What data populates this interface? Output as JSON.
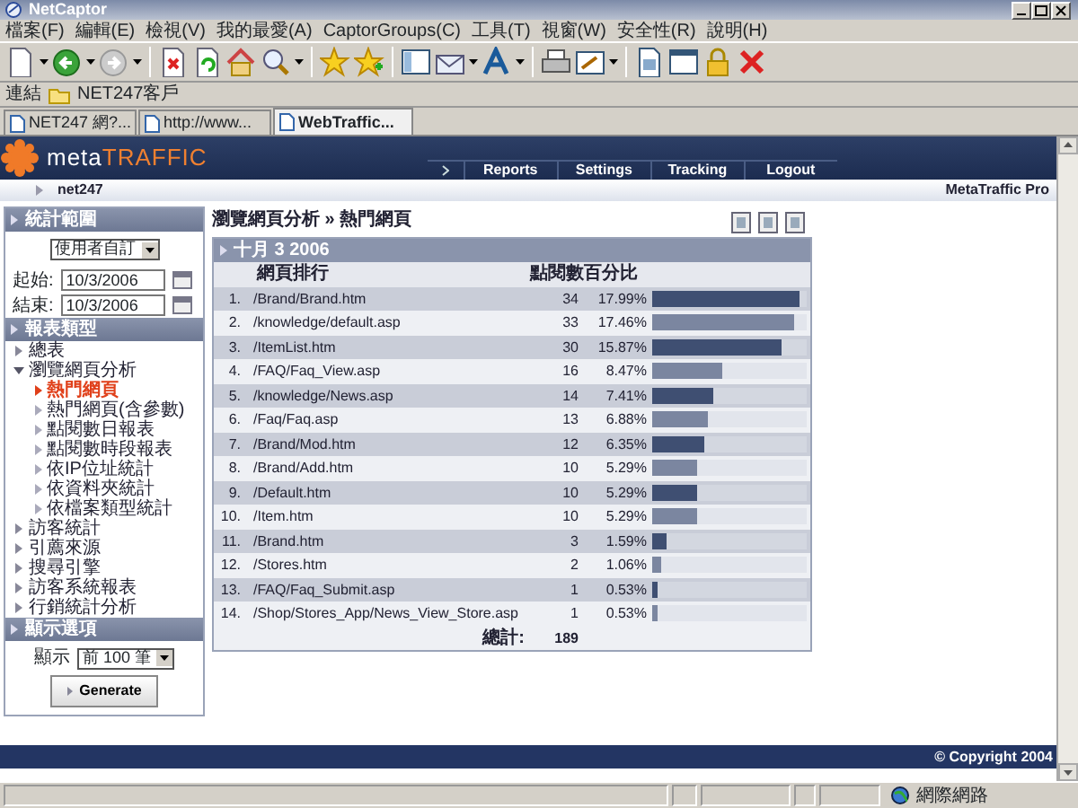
{
  "window": {
    "title": "NetCaptor"
  },
  "menu": [
    "檔案(F)",
    "編輯(E)",
    "檢視(V)",
    "我的最愛(A)",
    "CaptorGroups(C)",
    "工具(T)",
    "視窗(W)",
    "安全性(R)",
    "說明(H)"
  ],
  "links_bar": {
    "label": "連結",
    "items": [
      "NET247客戶"
    ]
  },
  "tabs": [
    {
      "label": "NET247 網?...",
      "selected": false
    },
    {
      "label": "http://www...",
      "selected": false
    },
    {
      "label": "WebTraffic...",
      "selected": true
    }
  ],
  "site": {
    "logo": {
      "prefix": "meta",
      "suffix": "TRAFFIC"
    },
    "nav": [
      "Reports",
      "Settings",
      "Tracking",
      "Logout"
    ],
    "account": "net247",
    "product": "MetaTraffic Pro",
    "footer": "© Copyright 2004"
  },
  "sidebar": {
    "range": {
      "title": "統計範圍",
      "preset": "使用者自訂",
      "start_label": "起始:",
      "start": "10/3/2006",
      "end_label": "結束:",
      "end": "10/3/2006"
    },
    "report_types": {
      "title": "報表類型",
      "items": [
        {
          "label": "總表",
          "expanded": false,
          "selected": false
        },
        {
          "label": "瀏覽網頁分析",
          "expanded": true,
          "selected": false,
          "children": [
            {
              "label": "熱門網頁",
              "selected": true
            },
            {
              "label": "熱門網頁(含參數)",
              "selected": false
            },
            {
              "label": "點閱數日報表",
              "selected": false
            },
            {
              "label": "點閱數時段報表",
              "selected": false
            },
            {
              "label": "依IP位址統計",
              "selected": false
            },
            {
              "label": "依資料夾統計",
              "selected": false
            },
            {
              "label": "依檔案類型統計",
              "selected": false
            }
          ]
        },
        {
          "label": "訪客統計",
          "expanded": false,
          "selected": false
        },
        {
          "label": "引薦來源",
          "expanded": false,
          "selected": false
        },
        {
          "label": "搜尋引擎",
          "expanded": false,
          "selected": false
        },
        {
          "label": "訪客系統報表",
          "expanded": false,
          "selected": false
        },
        {
          "label": "行銷統計分析",
          "expanded": false,
          "selected": false
        }
      ]
    },
    "display": {
      "title": "顯示選項",
      "label": "顯示",
      "value": "前 100 筆",
      "button": "Generate"
    }
  },
  "report": {
    "breadcrumb": "瀏覽網頁分析 » 熱門網頁",
    "date": "十月 3 2006",
    "columns": [
      "網頁排行",
      "點閱數",
      "百分比"
    ],
    "rows": [
      {
        "rank": "1.",
        "page": "/Brand/Brand.htm",
        "hits": "34",
        "percent": "17.99%",
        "level": 0.95
      },
      {
        "rank": "2.",
        "page": "/knowledge/default.asp",
        "hits": "33",
        "percent": "17.46%",
        "level": 0.92
      },
      {
        "rank": "3.",
        "page": "/ItemList.htm",
        "hits": "30",
        "percent": "15.87%",
        "level": 0.84
      },
      {
        "rank": "4.",
        "page": "/FAQ/Faq_View.asp",
        "hits": "16",
        "percent": "8.47%",
        "level": 0.45
      },
      {
        "rank": "5.",
        "page": "/knowledge/News.asp",
        "hits": "14",
        "percent": "7.41%",
        "level": 0.39
      },
      {
        "rank": "6.",
        "page": "/Faq/Faq.asp",
        "hits": "13",
        "percent": "6.88%",
        "level": 0.36
      },
      {
        "rank": "7.",
        "page": "/Brand/Mod.htm",
        "hits": "12",
        "percent": "6.35%",
        "level": 0.34
      },
      {
        "rank": "8.",
        "page": "/Brand/Add.htm",
        "hits": "10",
        "percent": "5.29%",
        "level": 0.29
      },
      {
        "rank": "9.",
        "page": "/Default.htm",
        "hits": "10",
        "percent": "5.29%",
        "level": 0.29
      },
      {
        "rank": "10.",
        "page": "/Item.htm",
        "hits": "10",
        "percent": "5.29%",
        "level": 0.29
      },
      {
        "rank": "11.",
        "page": "/Brand.htm",
        "hits": "3",
        "percent": "1.59%",
        "level": 0.09
      },
      {
        "rank": "12.",
        "page": "/Stores.htm",
        "hits": "2",
        "percent": "1.06%",
        "level": 0.06
      },
      {
        "rank": "13.",
        "page": "/FAQ/Faq_Submit.asp",
        "hits": "1",
        "percent": "0.53%",
        "level": 0.03
      },
      {
        "rank": "14.",
        "page": "/Shop/Stores_App/News_View_Store.asp",
        "hits": "1",
        "percent": "0.53%",
        "level": 0.03
      }
    ],
    "total_label": "總計:",
    "total": "189"
  },
  "status_bar": {
    "zone": "網際網路"
  }
}
